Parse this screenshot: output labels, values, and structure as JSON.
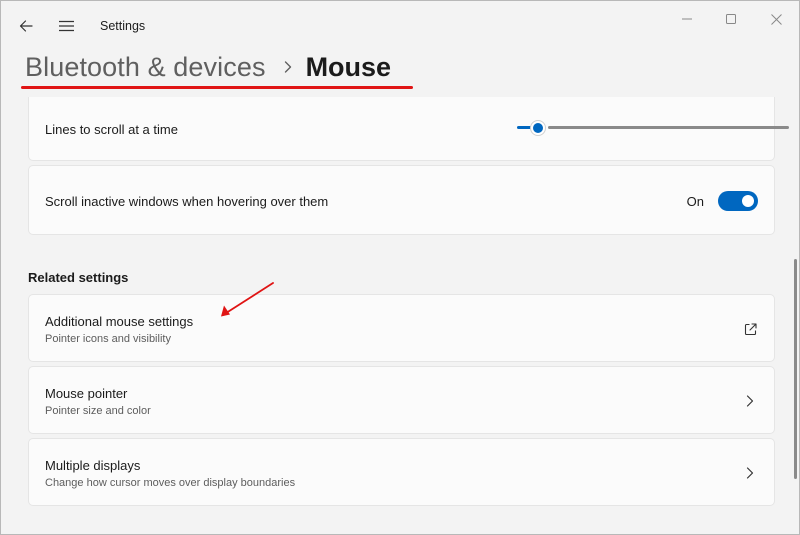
{
  "window": {
    "app_title": "Settings",
    "controls": {
      "minimize": "minimize-icon",
      "maximize": "maximize-icon",
      "close": "close-icon"
    }
  },
  "header": {
    "breadcrumb_parent": "Bluetooth & devices",
    "breadcrumb_current": "Mouse"
  },
  "scroll_lines": {
    "label": "Lines to scroll at a time",
    "slider_value_fraction": 0.05
  },
  "scroll_inactive": {
    "label": "Scroll inactive windows when hovering over them",
    "toggle_label": "On",
    "toggle_on": true
  },
  "related": {
    "heading": "Related settings",
    "items": [
      {
        "title": "Additional mouse settings",
        "subtitle": "Pointer icons and visibility",
        "icon": "external-link-icon"
      },
      {
        "title": "Mouse pointer",
        "subtitle": "Pointer size and color",
        "icon": "chevron-right-icon"
      },
      {
        "title": "Multiple displays",
        "subtitle": "Change how cursor moves over display boundaries",
        "icon": "chevron-right-icon"
      }
    ]
  },
  "colors": {
    "accent": "#0067c0",
    "annotation": "#e01414",
    "background": "#f3f3f3",
    "card": "#fbfbfb"
  }
}
